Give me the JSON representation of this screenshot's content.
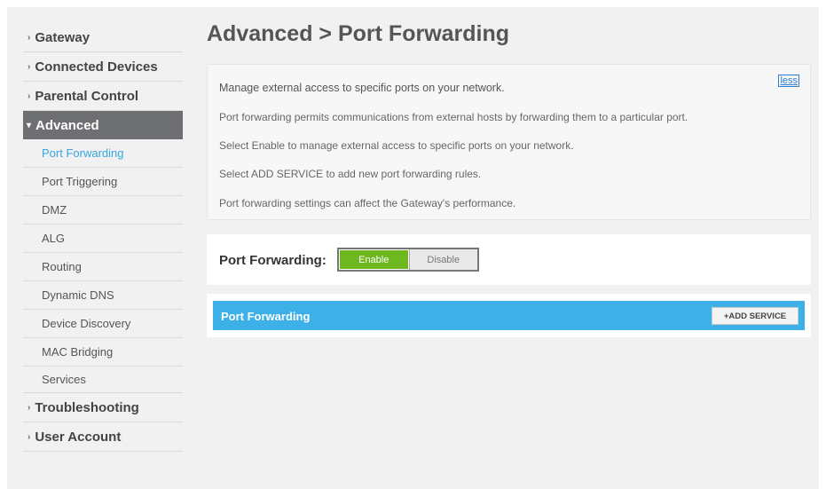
{
  "sidebar": {
    "top_items": [
      {
        "label": "Gateway"
      },
      {
        "label": "Connected Devices"
      },
      {
        "label": "Parental Control"
      },
      {
        "label": "Advanced"
      }
    ],
    "advanced_sub_items": [
      {
        "label": "Port Forwarding",
        "selected": true
      },
      {
        "label": "Port Triggering"
      },
      {
        "label": "DMZ"
      },
      {
        "label": "ALG"
      },
      {
        "label": "Routing"
      },
      {
        "label": "Dynamic DNS"
      },
      {
        "label": "Device Discovery"
      },
      {
        "label": "MAC Bridging"
      },
      {
        "label": "Services"
      }
    ],
    "bottom_items": [
      {
        "label": "Troubleshooting"
      },
      {
        "label": "User Account"
      }
    ]
  },
  "page_title": "Advanced > Port Forwarding",
  "info": {
    "lines": [
      "Manage external access to specific ports on your network.",
      "Port forwarding permits communications from external hosts by forwarding them to a particular port.",
      "Select Enable to manage external access to specific ports on your network.",
      "Select ADD SERVICE to add new port forwarding rules.",
      "Port forwarding settings can affect the Gateway's performance."
    ],
    "less_link": "less"
  },
  "toggle": {
    "label": "Port Forwarding:",
    "enable": "Enable",
    "disable": "Disable",
    "state": "enabled"
  },
  "pf_section": {
    "title": "Port Forwarding",
    "add_button": "+ADD SERVICE"
  },
  "colors": {
    "accent_blue": "#3eb0e8",
    "enable_green": "#6fb71f",
    "active_nav": "#6d6f72",
    "link_blue": "#35a6e3"
  }
}
